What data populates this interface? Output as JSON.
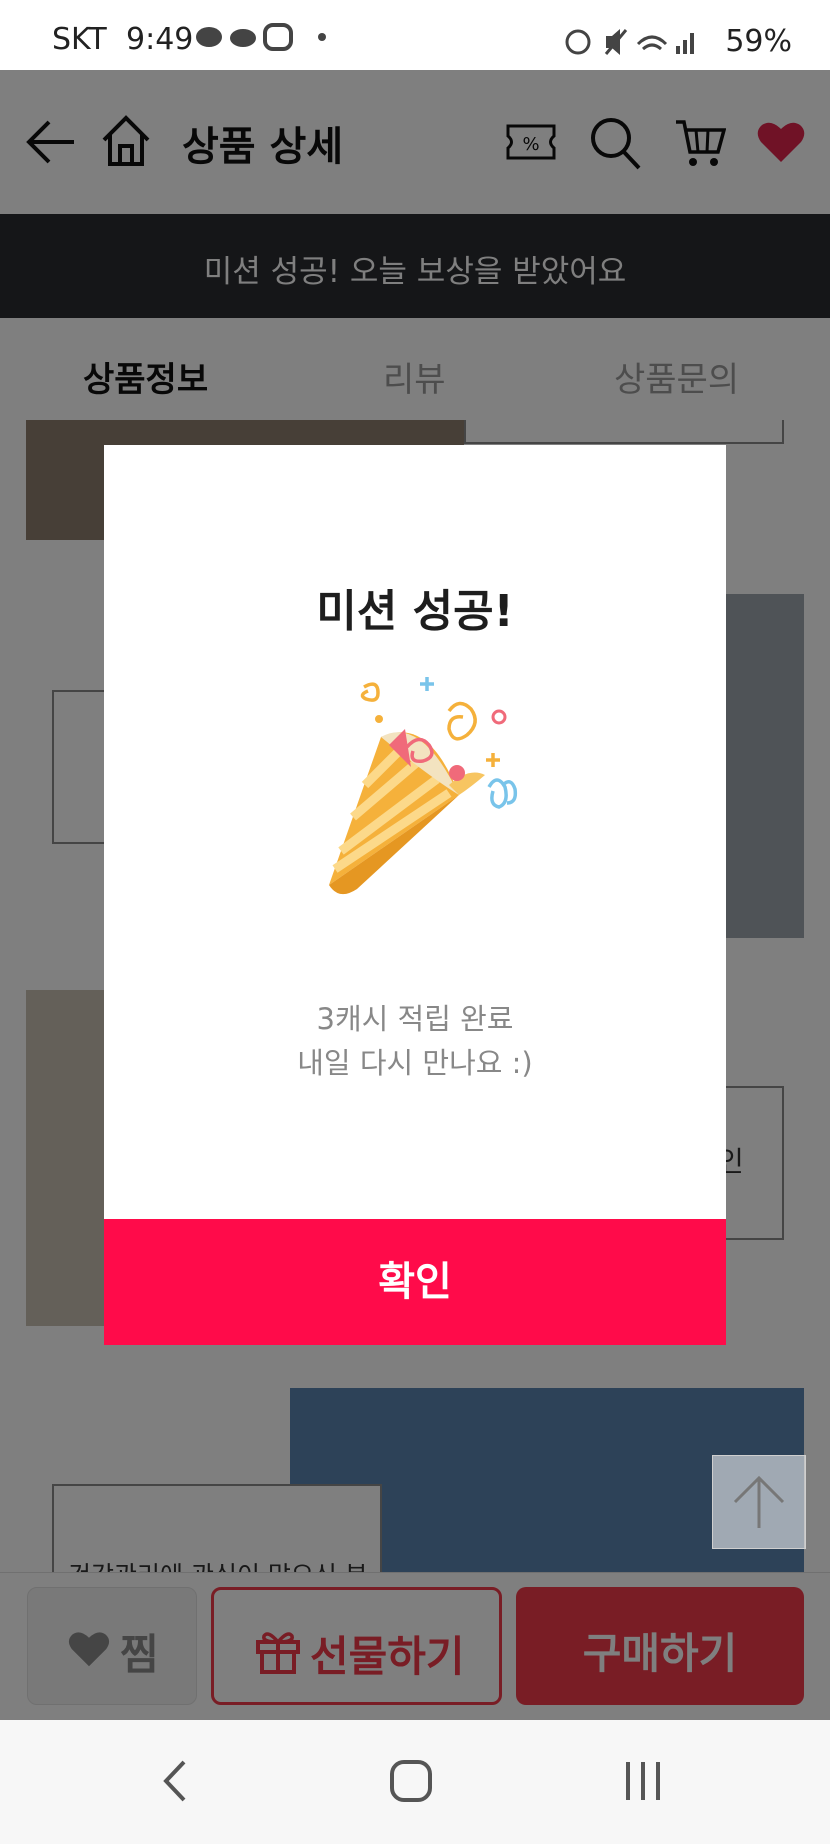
{
  "status_bar": {
    "carrier": "SKT",
    "time": "9:49",
    "battery": "59%"
  },
  "header": {
    "title": "상품 상세",
    "icons": [
      "back-arrow-icon",
      "home-icon",
      "coupon-icon",
      "search-icon",
      "cart-icon",
      "heart-icon"
    ],
    "heart_color": "#e0254c"
  },
  "banner": {
    "text": "미션 성공! 오늘 보상을 받았어요"
  },
  "tabs": [
    {
      "label": "상품정보",
      "active": true
    },
    {
      "label": "리뷰",
      "active": false
    },
    {
      "label": "상품문의",
      "active": false
    }
  ],
  "content": {
    "partial_text_1": "인",
    "partial_text_2": "건강관리에 관심이 많으신 분"
  },
  "modal": {
    "title": "미션 성공!",
    "message_line1": "3캐시 적립 완료",
    "message_line2": "내일 다시 만나요 :)",
    "confirm_label": "확인",
    "accent": "#ff0b4a"
  },
  "bottom_bar": {
    "wish_label": "찜",
    "gift_label": "선물하기",
    "buy_label": "구매하기",
    "accent": "#f23b4a"
  }
}
